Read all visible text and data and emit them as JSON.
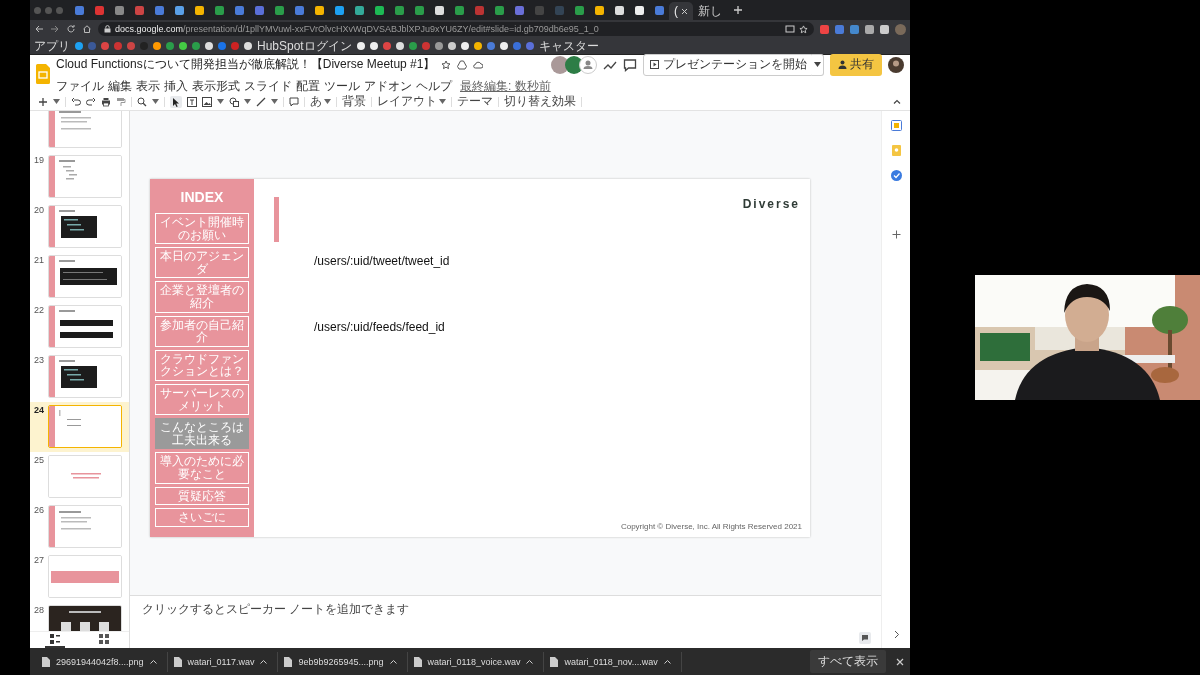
{
  "browser": {
    "tabs": [
      {
        "label": "(",
        "selected": true
      },
      {
        "label": "新し",
        "selected": false
      }
    ],
    "url_host": "docs.google.com",
    "url_path": "/presentation/d/1pllYMVuwl-xxFVrOlvcHXvWqDVSABJblXPJu9xYU6ZY/edit#slide=id.gb709db6e95_1_0",
    "bookmarks": [
      {
        "label": "アプリ"
      },
      {
        "label": "HubSpotログイン"
      },
      {
        "label": "キャスター"
      }
    ]
  },
  "document": {
    "title": "Cloud Functionsについて開発担当が徹底解説！【Diverse Meetup #1】",
    "menus": [
      "ファイル",
      "編集",
      "表示",
      "挿入",
      "表示形式",
      "スライド",
      "配置",
      "ツール",
      "アドオン",
      "ヘルプ"
    ],
    "last_edit": "最終編集: 数秒前",
    "present_button": "プレゼンテーションを開始",
    "share_button": "共有"
  },
  "toolbar": {
    "input_tool": "あ",
    "text_buttons": [
      {
        "label": "背景",
        "dropdown": false
      },
      {
        "label": "レイアウト",
        "dropdown": true
      },
      {
        "label": "テーマ",
        "dropdown": false
      },
      {
        "label": "切り替え効果",
        "dropdown": false
      }
    ]
  },
  "filmstrip": {
    "slides": [
      {
        "kind": "text",
        "selected": false
      },
      {
        "number": "19",
        "kind": "tree",
        "selected": false
      },
      {
        "number": "20",
        "kind": "code",
        "selected": false
      },
      {
        "number": "21",
        "kind": "code-wide",
        "selected": false
      },
      {
        "number": "22",
        "kind": "code-bars",
        "selected": false
      },
      {
        "number": "23",
        "kind": "code",
        "selected": false
      },
      {
        "number": "24",
        "kind": "blank",
        "selected": true
      },
      {
        "number": "25",
        "kind": "pink-text",
        "selected": false
      },
      {
        "number": "26",
        "kind": "text",
        "selected": false
      },
      {
        "number": "27",
        "kind": "band",
        "selected": false
      },
      {
        "number": "28",
        "kind": "dark",
        "selected": false
      }
    ],
    "views": [
      {
        "selected": true
      },
      {
        "selected": false
      }
    ]
  },
  "slide": {
    "index_title": "INDEX",
    "index_items": [
      {
        "label": "イベント開催時のお願い",
        "selected": false
      },
      {
        "label": "本日のアジェンダ",
        "selected": false
      },
      {
        "label": "企業と登壇者の紹介",
        "selected": false
      },
      {
        "label": "参加者の自己紹介",
        "selected": false
      },
      {
        "label": "クラウドファンクションとは？",
        "selected": false
      },
      {
        "label": "サーバーレスのメリット",
        "selected": false
      },
      {
        "label": "こんなところは工夫出来る",
        "selected": true
      },
      {
        "label": "導入のために必要なこと",
        "selected": false
      },
      {
        "label": "質疑応答",
        "selected": false
      },
      {
        "label": "さいごに",
        "selected": false
      }
    ],
    "logo": "Diverse",
    "lines": [
      "/users/:uid/tweet/tweet_id",
      "/users/:uid/feeds/feed_id"
    ],
    "copyright": "Copyright © Diverse, Inc. All Rights Reserved 2021"
  },
  "notes": {
    "placeholder": "クリックするとスピーカー ノートを追加できます"
  },
  "downloads": {
    "files": [
      "29691944042f8....png",
      "watari_0117.wav",
      "9eb9b9265945....png",
      "watari_0118_voice.wav",
      "watari_0118_nov....wav"
    ],
    "show_all": "すべて表示"
  }
}
